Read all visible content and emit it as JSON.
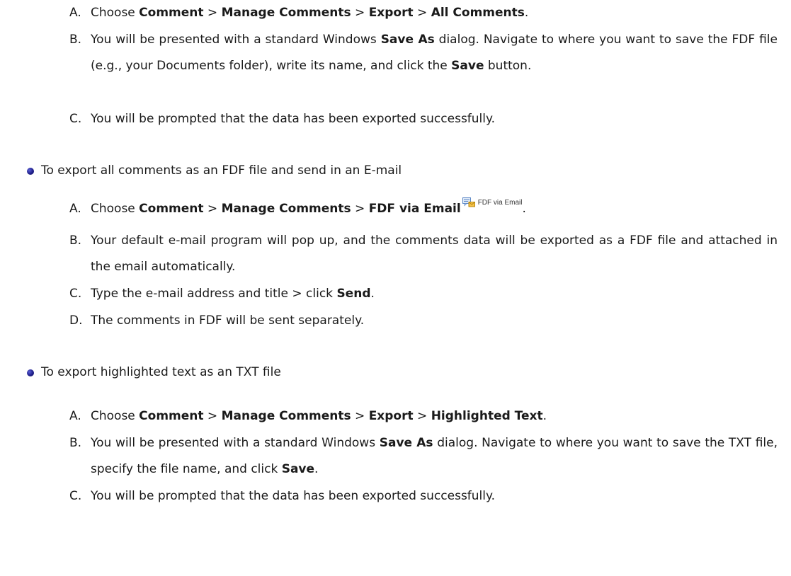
{
  "section1": {
    "steps": [
      {
        "marker": "A.",
        "parts": [
          {
            "t": "Choose ",
            "b": false
          },
          {
            "t": "Comment",
            "b": true
          },
          {
            "t": " > ",
            "b": false
          },
          {
            "t": "Manage Comments",
            "b": true
          },
          {
            "t": " > ",
            "b": false
          },
          {
            "t": "Export",
            "b": true
          },
          {
            "t": " > ",
            "b": false
          },
          {
            "t": "All Comments",
            "b": true
          },
          {
            "t": ".",
            "b": false
          }
        ]
      },
      {
        "marker": "B.",
        "parts": [
          {
            "t": "You will be presented with a standard Windows ",
            "b": false
          },
          {
            "t": "Save As",
            "b": true
          },
          {
            "t": " dialog. Navigate to where you want to save the FDF file (e.g., your Documents folder), write its name, and click the ",
            "b": false
          },
          {
            "t": "Save",
            "b": true
          },
          {
            "t": " button.",
            "b": false
          }
        ]
      },
      {
        "marker": "C.",
        "parts": [
          {
            "t": "You will be prompted that the data has been exported successfully.",
            "b": false
          }
        ]
      }
    ]
  },
  "bullet1": {
    "text": "To export all comments as an FDF file and send in an E-mail"
  },
  "section2": {
    "steps": [
      {
        "marker": "A.",
        "parts": [
          {
            "t": "Choose ",
            "b": false
          },
          {
            "t": "Comment",
            "b": true
          },
          {
            "t": " > ",
            "b": false
          },
          {
            "t": "Manage Comments",
            "b": true
          },
          {
            "t": " > ",
            "b": false
          },
          {
            "t": "FDF via Email",
            "b": true
          }
        ],
        "icon_label": "FDF via Email",
        "trailing": "."
      },
      {
        "marker": "B.",
        "parts": [
          {
            "t": "Your default e-mail program will pop up, and the comments data will be exported as a FDF file and attached in the email automatically.",
            "b": false
          }
        ]
      },
      {
        "marker": "C.",
        "parts": [
          {
            "t": "Type the e-mail address and title > click ",
            "b": false
          },
          {
            "t": "Send",
            "b": true
          },
          {
            "t": ".",
            "b": false
          }
        ]
      },
      {
        "marker": "D.",
        "parts": [
          {
            "t": "The comments in FDF will be sent separately.",
            "b": false
          }
        ]
      }
    ]
  },
  "bullet2": {
    "text": "To export highlighted text as an TXT file"
  },
  "section3": {
    "steps": [
      {
        "marker": "A.",
        "parts": [
          {
            "t": "Choose ",
            "b": false
          },
          {
            "t": "Comment",
            "b": true
          },
          {
            "t": " > ",
            "b": false
          },
          {
            "t": "Manage Comments",
            "b": true
          },
          {
            "t": " > ",
            "b": false
          },
          {
            "t": "Export",
            "b": true
          },
          {
            "t": " > ",
            "b": false
          },
          {
            "t": "Highlighted Text",
            "b": true
          },
          {
            "t": ".",
            "b": false
          }
        ]
      },
      {
        "marker": "B.",
        "parts": [
          {
            "t": "You will be presented with a standard Windows ",
            "b": false
          },
          {
            "t": "Save As",
            "b": true
          },
          {
            "t": " dialog. Navigate to where you want to save the TXT file, specify the file name, and click ",
            "b": false
          },
          {
            "t": "Save",
            "b": true
          },
          {
            "t": ".",
            "b": false
          }
        ]
      },
      {
        "marker": "C.",
        "parts": [
          {
            "t": "You will be prompted that the data has been exported successfully.",
            "b": false
          }
        ]
      }
    ]
  }
}
